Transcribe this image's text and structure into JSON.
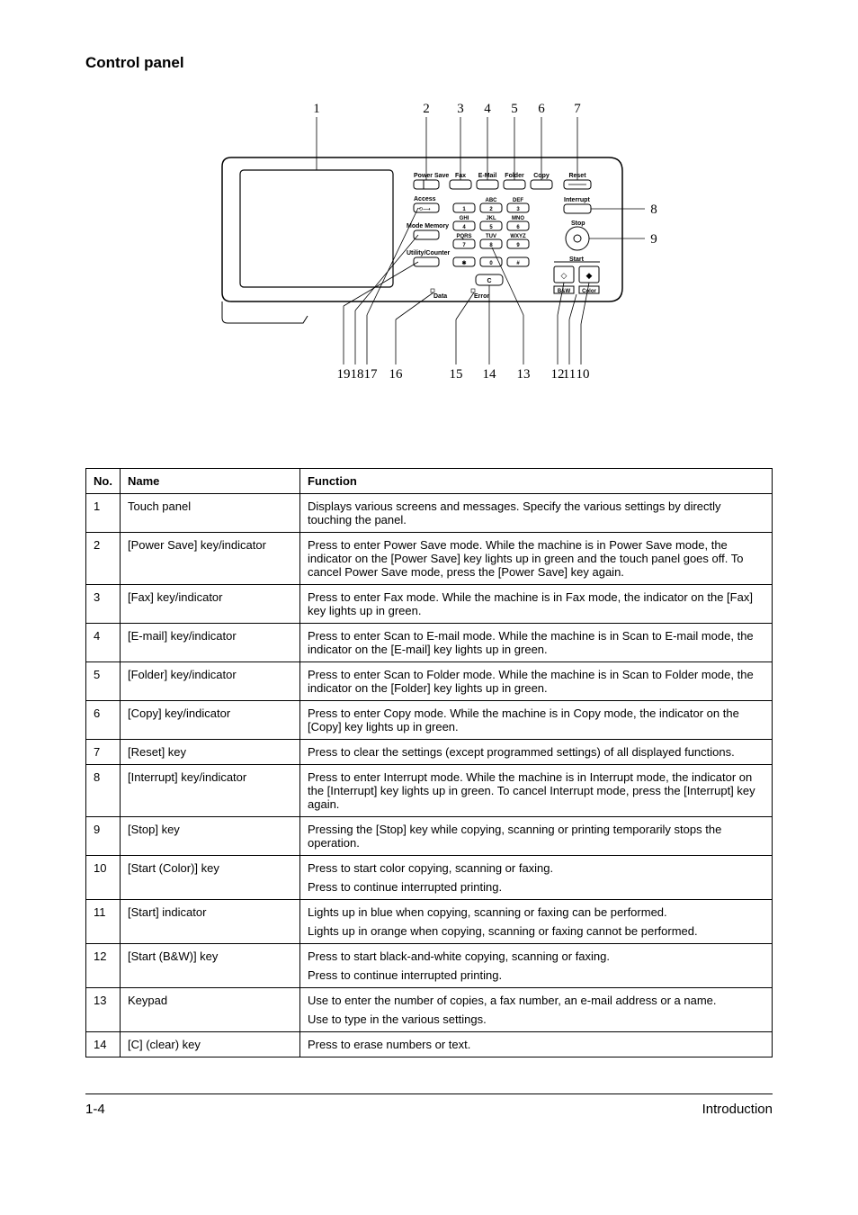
{
  "section_title": "Control panel",
  "diagram": {
    "top_callouts": [
      "1",
      "2",
      "3",
      "4",
      "5",
      "6",
      "7"
    ],
    "right_callouts": [
      "8",
      "9"
    ],
    "bottom_callouts": [
      "19",
      "18",
      "17",
      "16",
      "15",
      "14",
      "13",
      "12",
      "11",
      "10"
    ],
    "labels": {
      "power_save": "Power Save",
      "fax": "Fax",
      "email": "E-Mail",
      "folder": "Folder",
      "copy": "Copy",
      "reset": "Reset",
      "access": "Access",
      "interrupt": "Interrupt",
      "mode_memory": "Mode Memory",
      "stop": "Stop",
      "utility_counter": "Utility/Counter",
      "start": "Start",
      "bws": "B&W",
      "color": "Color",
      "data": "Data",
      "error": "Error",
      "c": "C"
    },
    "keypad": {
      "k1": {
        "n": "1",
        "t": ""
      },
      "k2": {
        "n": "2",
        "t": "ABC"
      },
      "k3": {
        "n": "3",
        "t": "DEF"
      },
      "k4": {
        "n": "4",
        "t": "GHI"
      },
      "k5": {
        "n": "5",
        "t": "JKL"
      },
      "k6": {
        "n": "6",
        "t": "MNO"
      },
      "k7": {
        "n": "7",
        "t": "PQRS"
      },
      "k8": {
        "n": "8",
        "t": "TUV"
      },
      "k9": {
        "n": "9",
        "t": "WXYZ"
      },
      "kstar": {
        "n": "✱",
        "t": ""
      },
      "k0": {
        "n": "0",
        "t": ""
      },
      "khash": {
        "n": "#",
        "t": ""
      }
    }
  },
  "table": {
    "headers": {
      "no": "No.",
      "name": "Name",
      "fn": "Function"
    },
    "rows": [
      {
        "no": "1",
        "name": "Touch panel",
        "fn": [
          "Displays various screens and messages. Specify the various settings by directly touching the panel."
        ]
      },
      {
        "no": "2",
        "name": "[Power Save] key/indicator",
        "fn": [
          "Press to enter Power Save mode. While the machine is in Power Save mode, the indicator on the [Power Save] key lights up in green and the touch panel goes off. To cancel Power Save mode, press the [Power Save] key again."
        ]
      },
      {
        "no": "3",
        "name": "[Fax] key/indicator",
        "fn": [
          "Press to enter Fax mode. While the machine is in Fax mode, the indicator on the [Fax] key lights up in green."
        ]
      },
      {
        "no": "4",
        "name": "[E-mail] key/indicator",
        "fn": [
          "Press to enter Scan to E-mail mode. While the machine is in Scan to E-mail mode, the indicator on the [E-mail] key lights up in green."
        ]
      },
      {
        "no": "5",
        "name": "[Folder] key/indicator",
        "fn": [
          "Press to enter Scan to Folder mode. While the machine is in Scan to Folder mode, the indicator on the [Folder] key lights up in green."
        ]
      },
      {
        "no": "6",
        "name": "[Copy] key/indicator",
        "fn": [
          "Press to enter Copy mode. While the machine is in Copy mode, the indicator on the [Copy] key lights up in green."
        ]
      },
      {
        "no": "7",
        "name": "[Reset] key",
        "fn": [
          "Press to clear the settings (except programmed settings) of all displayed functions."
        ]
      },
      {
        "no": "8",
        "name": "[Interrupt] key/indicator",
        "fn": [
          "Press to enter Interrupt mode. While the machine is in Interrupt mode, the indicator on the [Interrupt] key lights up in green. To cancel Interrupt mode, press the [Interrupt] key again."
        ]
      },
      {
        "no": "9",
        "name": "[Stop] key",
        "fn": [
          "Pressing the [Stop] key while copying, scanning or printing temporarily stops the operation."
        ]
      },
      {
        "no": "10",
        "name": "[Start (Color)] key",
        "fn": [
          "Press to start color copying, scanning or faxing.",
          "Press to continue interrupted printing."
        ]
      },
      {
        "no": "11",
        "name": "[Start] indicator",
        "fn": [
          "Lights up in blue when copying, scanning or faxing can be performed.",
          "Lights up in orange when copying, scanning or faxing cannot be performed."
        ]
      },
      {
        "no": "12",
        "name": "[Start (B&W)] key",
        "fn": [
          "Press to start black-and-white copying, scanning or faxing.",
          "Press to continue interrupted printing."
        ]
      },
      {
        "no": "13",
        "name": "Keypad",
        "fn": [
          "Use to enter the number of copies, a fax number, an e-mail address or a name.",
          "Use to type in the various settings."
        ]
      },
      {
        "no": "14",
        "name": "[C] (clear) key",
        "fn": [
          "Press to erase numbers or text."
        ]
      }
    ]
  },
  "footer": {
    "left": "1-4",
    "right": "Introduction"
  }
}
